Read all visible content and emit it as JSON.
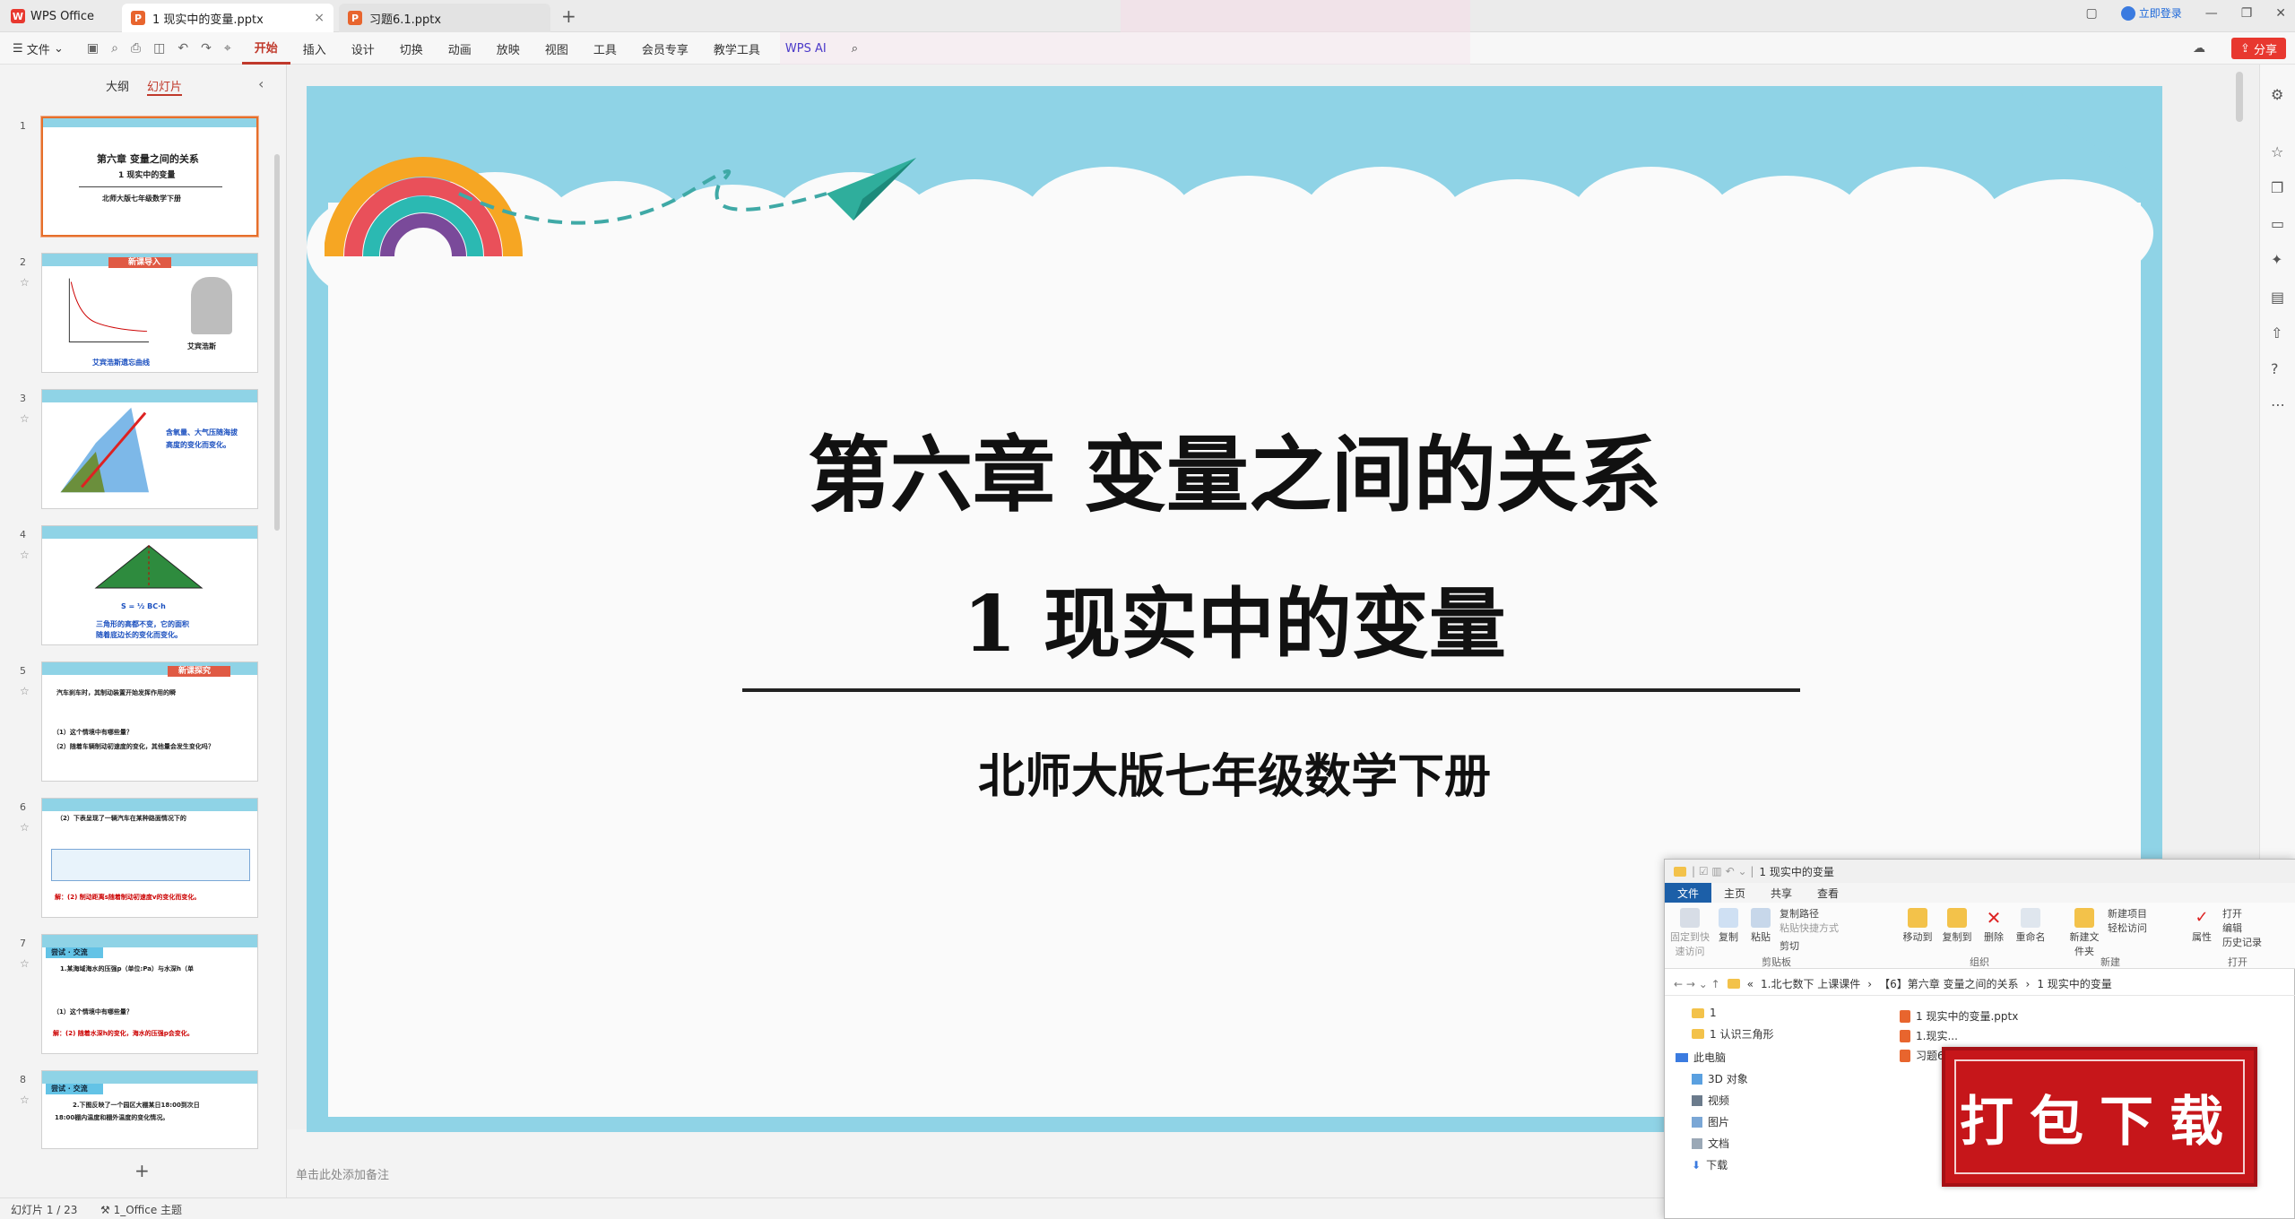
{
  "app": {
    "name": "WPS Office"
  },
  "tabs": [
    {
      "label": "1 现实中的变量.pptx",
      "active": true
    },
    {
      "label": "习题6.1.pptx",
      "active": false
    }
  ],
  "titlebar": {
    "login": "立即登录"
  },
  "menu": {
    "file": "文件",
    "items": [
      "开始",
      "插入",
      "设计",
      "切换",
      "动画",
      "放映",
      "视图",
      "工具",
      "会员专享",
      "教学工具",
      "WPS AI"
    ],
    "active": "开始",
    "share": "分享"
  },
  "leftpanel": {
    "tabs": [
      "大纲",
      "幻灯片"
    ],
    "active_tab": "幻灯片",
    "thumbs": [
      {
        "num": "1",
        "lines": [
          "第六章 变量之间的关系",
          "1 现实中的变量",
          "北师大版七年级数学下册"
        ]
      },
      {
        "num": "2",
        "lines": [
          "新课导入",
          "艾宾浩斯",
          "艾宾浩斯遗忘曲线"
        ]
      },
      {
        "num": "3",
        "lines": [
          "含氧量、大气压随海拔",
          "高度的变化而变化。"
        ]
      },
      {
        "num": "4",
        "lines": [
          "三角形的高都不变，它的面积",
          "随着底边长的变化而变化。"
        ]
      },
      {
        "num": "5",
        "lines": [
          "新课探究",
          "汽车刹车时，其制动装置开始发挥作用的瞬",
          "（1）这个情境中有哪些量？",
          "（2）随着车辆制动初速度的变化，其他量会发生变化吗？"
        ]
      },
      {
        "num": "6",
        "lines": [
          "（2）下表呈现了一辆汽车在某种路面情况下的",
          "解：(2) 制动距离s随着制动初速度v的变化而变化。"
        ]
      },
      {
        "num": "7",
        "lines": [
          "尝试 · 交流",
          "1.某海域海水的压强p（单位:Pa）与水深h（单",
          "（1）这个情境中有哪些量？",
          "解：(2) 随着水深h的变化，海水的压强p会变化。"
        ]
      },
      {
        "num": "8",
        "lines": [
          "尝试 · 交流",
          "2.下图反映了一个园区大棚某日18:00到次日",
          "18:00棚内温度和棚外温度的变化情况。"
        ]
      }
    ]
  },
  "slide": {
    "title": "第六章 变量之间的关系",
    "subtitle": "1 现实中的变量",
    "textbook": "北师大版七年级数学下册"
  },
  "notes_placeholder": "单击此处添加备注",
  "status": {
    "slide": "幻灯片 1 / 23",
    "theme": "1_Office 主题"
  },
  "explorer": {
    "title": "1 现实中的变量",
    "tabs": [
      "文件",
      "主页",
      "共享",
      "查看"
    ],
    "ribbon": {
      "pin": "固定到快速访问",
      "copy": "复制",
      "paste": "粘贴",
      "copy_path": "复制路径",
      "paste_shortcut": "粘贴快捷方式",
      "cut": "剪切",
      "clipboard": "剪贴板",
      "move_to": "移动到",
      "copy_to": "复制到",
      "delete": "删除",
      "rename": "重命名",
      "organize": "组织",
      "new_folder": "新建文件夹",
      "new_item": "新建项目",
      "easy_access": "轻松访问",
      "new": "新建",
      "properties": "属性",
      "open": "打开",
      "edit": "编辑",
      "history": "历史记录",
      "open_group": "打开"
    },
    "breadcrumb": [
      "1.北七数下 上课课件",
      "【6】第六章 变量之间的关系",
      "1 现实中的变量"
    ],
    "nav": [
      "1",
      "1 认识三角形",
      "此电脑",
      "3D 对象",
      "视频",
      "图片",
      "文档",
      "下载"
    ],
    "files": [
      "1 现实中的变量.pptx",
      "1.现实...",
      "习题6.1..."
    ]
  },
  "stamp": {
    "text": "打包下载"
  }
}
